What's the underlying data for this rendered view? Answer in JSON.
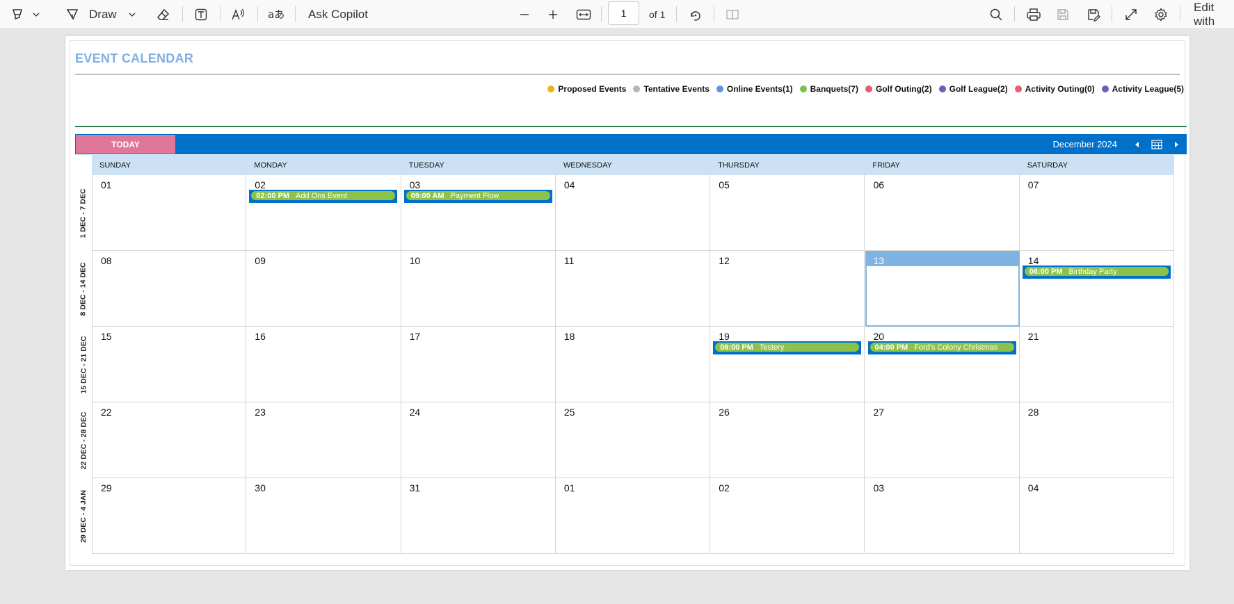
{
  "toolbar": {
    "draw_label": "Draw",
    "copilot_label": "Ask Copilot",
    "page_current": "1",
    "page_total": "of 1",
    "edit_label": "Edit with"
  },
  "calendar": {
    "title": "EVENT CALENDAR",
    "legend": [
      {
        "label": "Proposed Events",
        "color": "#f2b21c"
      },
      {
        "label": "Tentative Events",
        "color": "#b5b5b5"
      },
      {
        "label": "Online Events(1)",
        "color": "#5c95e0"
      },
      {
        "label": "Banquets(7)",
        "color": "#7cbf4a"
      },
      {
        "label": "Golf Outing(2)",
        "color": "#e45c6d"
      },
      {
        "label": "Golf League(2)",
        "color": "#6c5fb5"
      },
      {
        "label": "Activity Outing(0)",
        "color": "#e45c6d"
      },
      {
        "label": "Activity League(5)",
        "color": "#6c5fb5"
      }
    ],
    "today_button": "TODAY",
    "month_label": "December 2024",
    "day_headers": [
      "SUNDAY",
      "MONDAY",
      "TUESDAY",
      "WEDNESDAY",
      "THURSDAY",
      "FRIDAY",
      "SATURDAY"
    ],
    "weeks": [
      {
        "label": "1 DEC - 7 DEC",
        "days": [
          "01",
          "02",
          "03",
          "04",
          "05",
          "06",
          "07"
        ]
      },
      {
        "label": "8 DEC - 14 DEC",
        "days": [
          "08",
          "09",
          "10",
          "11",
          "12",
          "13",
          "14"
        ]
      },
      {
        "label": "15 DEC - 21 DEC",
        "days": [
          "15",
          "16",
          "17",
          "18",
          "19",
          "20",
          "21"
        ]
      },
      {
        "label": "22 DEC - 28 DEC",
        "days": [
          "22",
          "23",
          "24",
          "25",
          "26",
          "27",
          "28"
        ]
      },
      {
        "label": "29 DEC - 4 JAN",
        "days": [
          "29",
          "30",
          "31",
          "01",
          "02",
          "03",
          "04"
        ]
      }
    ],
    "today": {
      "week": 1,
      "day": 5
    },
    "events": [
      {
        "week": 0,
        "day": 1,
        "time": "02:00 PM",
        "title": "Add Ons Event"
      },
      {
        "week": 0,
        "day": 2,
        "time": "09:00 AM",
        "title": "Payment Flow"
      },
      {
        "week": 1,
        "day": 6,
        "time": "06:00 PM",
        "title": "Birthday Party"
      },
      {
        "week": 2,
        "day": 4,
        "time": "06:00 PM",
        "title": "Testery"
      },
      {
        "week": 2,
        "day": 5,
        "time": "04:00 PM",
        "title": "Ford's Colony Christmas"
      }
    ]
  }
}
